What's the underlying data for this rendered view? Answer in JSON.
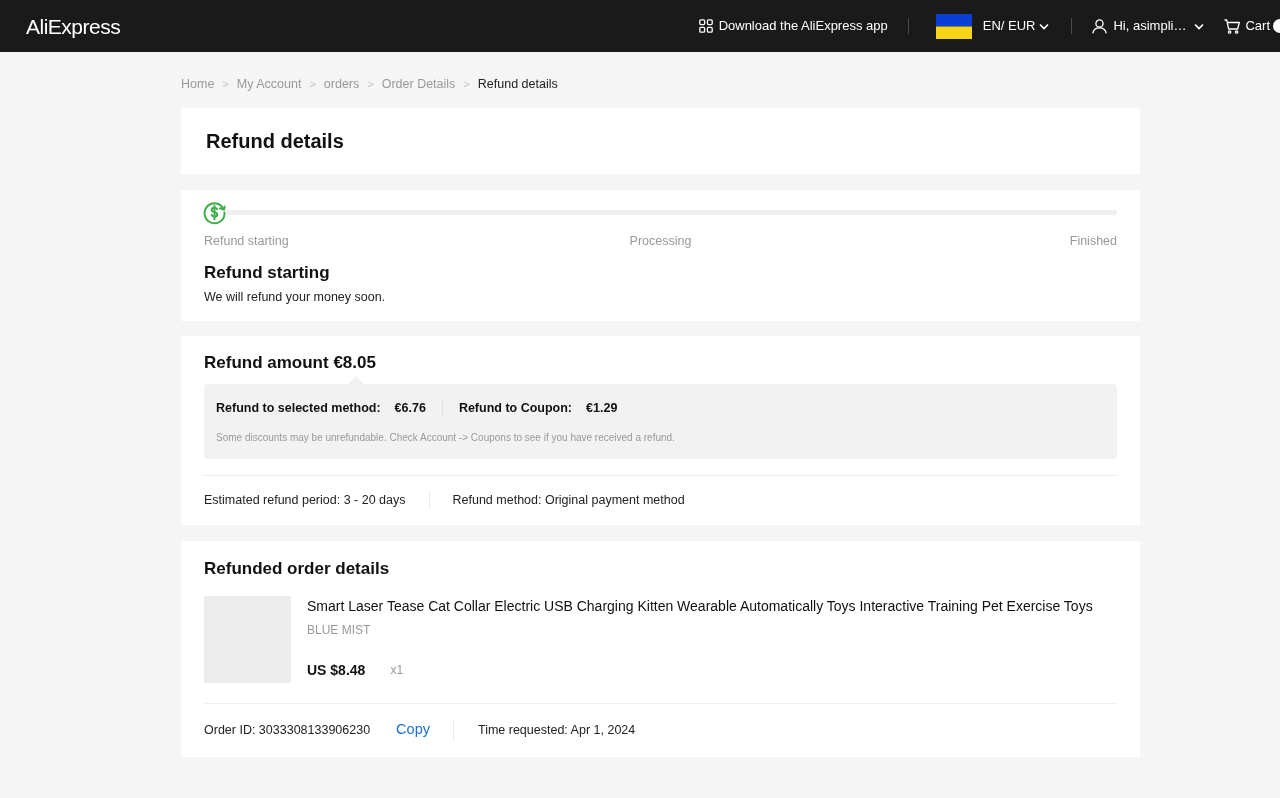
{
  "header": {
    "logo": "AliExpress",
    "app_link": "Download the AliExpress app",
    "locale": "EN/ EUR",
    "account": "Hi, asimpli…",
    "cart": "Cart"
  },
  "breadcrumb": {
    "separator": ">",
    "items": [
      {
        "label": "Home",
        "selected": false
      },
      {
        "label": "My Account",
        "selected": false
      },
      {
        "label": "orders",
        "selected": false
      },
      {
        "label": "Order Details",
        "selected": false
      },
      {
        "label": "Refund details",
        "selected": true
      }
    ]
  },
  "page_title": "Refund details",
  "progress": {
    "steps": [
      {
        "label": "Refund starting",
        "selected": true
      },
      {
        "label": "Processing",
        "selected": false
      },
      {
        "label": "Finished",
        "selected": false
      }
    ],
    "status_title": "Refund starting",
    "status_text": "We will refund your money soon."
  },
  "refund_amount": {
    "title": "Refund amount €8.05",
    "breakdown": [
      {
        "label": "Refund to selected method:",
        "value": "€6.76"
      },
      {
        "label": "Refund to Coupon:",
        "value": "€1.29"
      }
    ],
    "note": "Some discounts may be unrefundable. Check Account -> Coupons to see if you have received a refund.",
    "details": [
      "Estimated refund period: 3 - 20 days",
      "Refund method: Original payment method"
    ]
  },
  "refunded_order": {
    "title": "Refunded order details",
    "product": {
      "title": "Smart Laser Tease Cat Collar Electric USB Charging Kitten Wearable Automatically Toys Interactive Training Pet Exercise Toys",
      "variant": "BLUE MIST",
      "price": "US $8.48",
      "quantity": "x1"
    },
    "order_id": "Order ID: 3033308133906230",
    "copy_button": "Copy",
    "time_requested": "Time requested: Apr 1, 2024"
  }
}
